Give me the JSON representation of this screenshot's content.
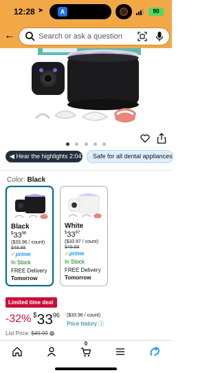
{
  "status_bar": {
    "time": "12:28",
    "battery": "90"
  },
  "search": {
    "placeholder": "Search or ask a question"
  },
  "carousel": {
    "total": 5,
    "active": 0
  },
  "highlights": {
    "button_label": "Hear the highlights 2:04",
    "chip_label": "Safe for all dental appliances?"
  },
  "color": {
    "label": "Color:",
    "selected": "Black"
  },
  "variants": [
    {
      "name": "Black",
      "price_currency": "$",
      "price_whole": "33",
      "price_cents": "96",
      "per_count": "($33.96 / count)",
      "list_price": "$49.99",
      "prime": "prime",
      "stock": "In Stock",
      "delivery": "FREE Delivery",
      "delivery_day": "Tomorrow"
    },
    {
      "name": "White",
      "price_currency": "$",
      "price_whole": "33",
      "price_cents": "97",
      "per_count": "($33.97 / count)",
      "list_price": "$49.99",
      "prime": "prime",
      "stock": "In Stock",
      "delivery": "FREE Delivery",
      "delivery_day": "Tomorrow"
    }
  ],
  "deal": {
    "badge": "Limited time deal",
    "discount": "-32%",
    "currency": "$",
    "whole": "33",
    "cents": "96",
    "per_count": "($33.96 / count)",
    "history_link": "Price history",
    "list_label": "List Price:",
    "list_value": "$49.99"
  },
  "tabbar": {
    "cart_count": "0"
  },
  "colors": {
    "header": "#f3a847",
    "link": "#007185",
    "deal": "#cc0c39",
    "stock": "#007600",
    "prime": "#1399ff"
  }
}
